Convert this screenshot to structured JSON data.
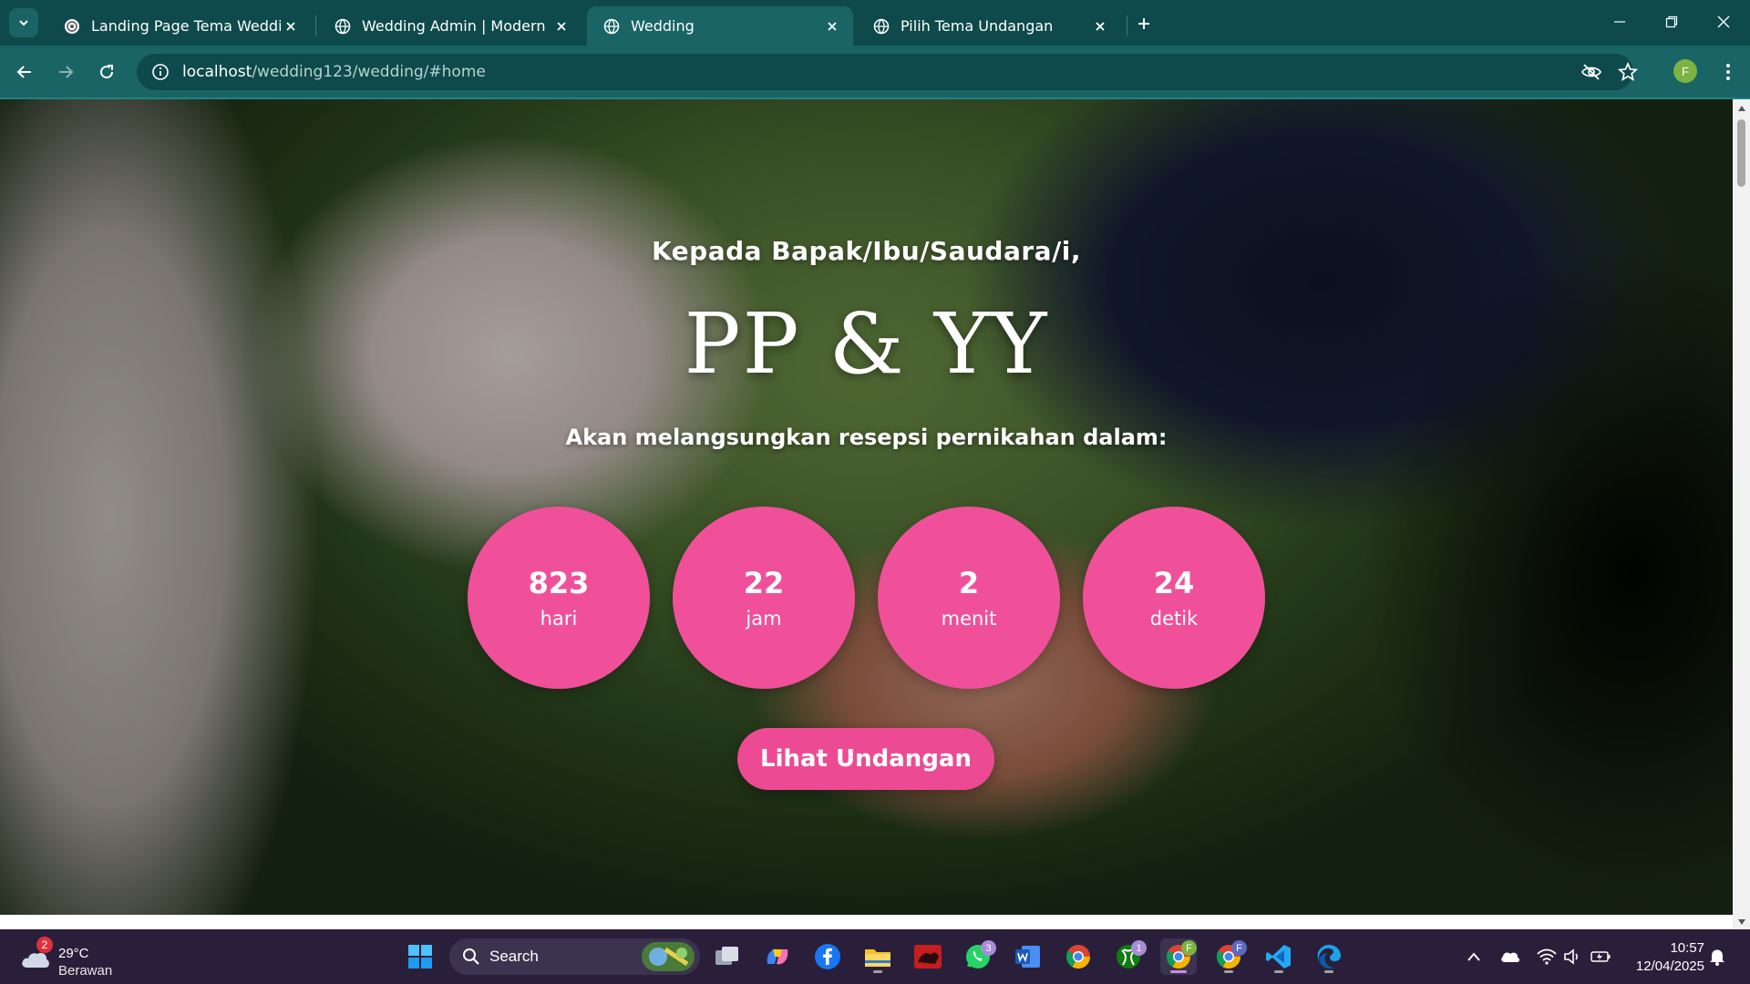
{
  "browser": {
    "tabs": [
      {
        "title": "Landing Page Tema Wedding",
        "active": false
      },
      {
        "title": "Wedding Admin | Modern Dash",
        "active": false
      },
      {
        "title": "Wedding",
        "active": true
      },
      {
        "title": "Pilih Tema Undangan",
        "active": false
      }
    ],
    "url_host": "localhost",
    "url_path": "/wedding123/wedding/#home",
    "profile_initial": "F",
    "theme_color": "#1a6466"
  },
  "page": {
    "greeting": "Kepada Bapak/Ibu/Saudara/i,",
    "couple_names": "PP & YY",
    "subtitle": "Akan melangsungkan resepsi pernikahan dalam:",
    "countdown": [
      {
        "value": "823",
        "unit": "hari"
      },
      {
        "value": "22",
        "unit": "jam"
      },
      {
        "value": "2",
        "unit": "menit"
      },
      {
        "value": "24",
        "unit": "detik"
      }
    ],
    "cta_label": "Lihat Undangan",
    "accent_color": "#f0509a"
  },
  "taskbar": {
    "weather_temp": "29°C",
    "weather_desc": "Berawan",
    "weather_badge": "2",
    "search_label": "Search",
    "whatsapp_badge": "3",
    "xbox_badge": "1",
    "chrome_profile_1": "F",
    "chrome_profile_2": "F",
    "time": "10:57",
    "date": "12/04/2025"
  }
}
